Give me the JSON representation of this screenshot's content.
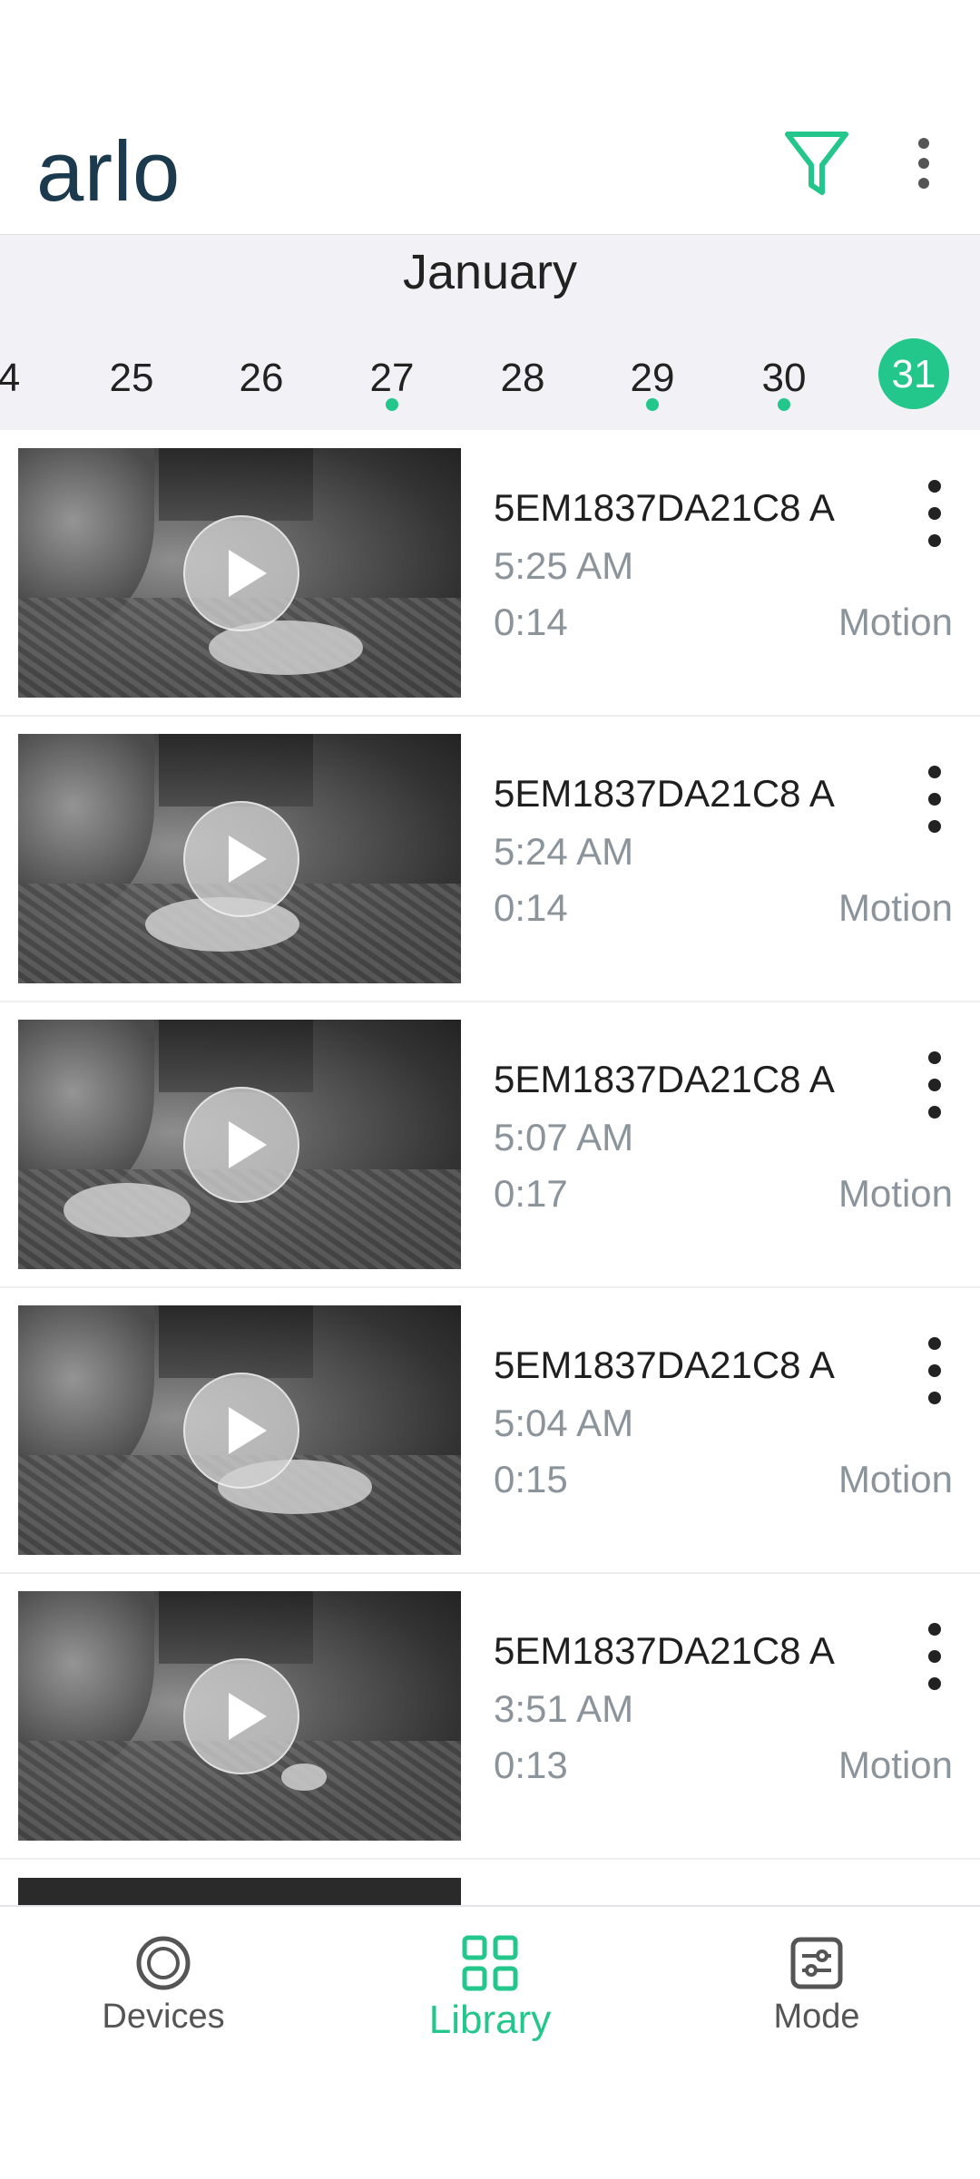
{
  "app": {
    "logo": "arlo"
  },
  "header": {
    "filter_icon": "filter-icon",
    "more_icon": "more-vertical-icon"
  },
  "calendar": {
    "month": "January",
    "days": [
      {
        "label": "4",
        "has_recordings": false,
        "selected": false
      },
      {
        "label": "25",
        "has_recordings": false,
        "selected": false
      },
      {
        "label": "26",
        "has_recordings": false,
        "selected": false
      },
      {
        "label": "27",
        "has_recordings": true,
        "selected": false
      },
      {
        "label": "28",
        "has_recordings": false,
        "selected": false
      },
      {
        "label": "29",
        "has_recordings": true,
        "selected": false
      },
      {
        "label": "30",
        "has_recordings": true,
        "selected": false
      },
      {
        "label": "31",
        "has_recordings": true,
        "selected": true
      }
    ]
  },
  "recordings": [
    {
      "device": "5EM1837DA21C8  A",
      "time": "5:25 AM",
      "duration": "0:14",
      "type": "Motion"
    },
    {
      "device": "5EM1837DA21C8  A",
      "time": "5:24 AM",
      "duration": "0:14",
      "type": "Motion"
    },
    {
      "device": "5EM1837DA21C8  A",
      "time": "5:07 AM",
      "duration": "0:17",
      "type": "Motion"
    },
    {
      "device": "5EM1837DA21C8  A",
      "time": "5:04 AM",
      "duration": "0:15",
      "type": "Motion"
    },
    {
      "device": "5EM1837DA21C8  A",
      "time": "3:51 AM",
      "duration": "0:13",
      "type": "Motion"
    }
  ],
  "bottom_nav": {
    "devices": "Devices",
    "library": "Library",
    "mode": "Mode",
    "active": "library"
  },
  "colors": {
    "accent": "#23c68b",
    "brand": "#1b3a4d"
  }
}
